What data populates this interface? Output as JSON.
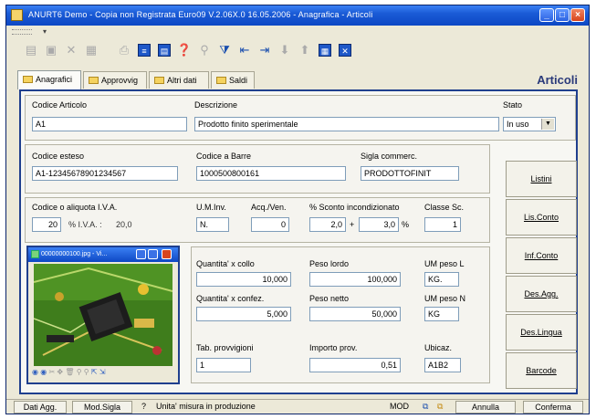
{
  "window": {
    "title": "ANURT6  Demo - Copia non Registrata          Euro09 V.2.06X.0 16.05.2006 - Anagrafica - Articoli"
  },
  "tabs": [
    {
      "label": "Anagrafici"
    },
    {
      "label": "Approvvig"
    },
    {
      "label": "Altri dati"
    },
    {
      "label": "Saldi"
    }
  ],
  "page_title": "Articoli",
  "form": {
    "codice_articolo": {
      "label": "Codice Articolo",
      "value": "A1"
    },
    "descrizione": {
      "label": "Descrizione",
      "value": "Prodotto finito sperimentale"
    },
    "stato": {
      "label": "Stato",
      "value": "In uso"
    },
    "codice_esteso": {
      "label": "Codice esteso",
      "value": "A1-12345678901234567"
    },
    "codice_barre": {
      "label": "Codice a Barre",
      "value": "1000500800161"
    },
    "sigla_commerc": {
      "label": "Sigla commerc.",
      "value": "PRODOTTOFINIT"
    },
    "codice_iva": {
      "label": "Codice o aliquota I.V.A.",
      "value": "20",
      "pct_label": "% I.V.A. :",
      "pct_value": "20,0"
    },
    "um_inv": {
      "label": "U.M.Inv.",
      "value": "N."
    },
    "acq_ven": {
      "label": "Acq./Ven.",
      "value": "0"
    },
    "sconto": {
      "label": "% Sconto incondizionato",
      "value1": "2,0",
      "plus": "+",
      "value2": "3,0",
      "pct": "%"
    },
    "classe_sc": {
      "label": "Classe Sc.",
      "value": "1"
    },
    "qta_collo": {
      "label": "Quantita' x collo",
      "value": "10,000"
    },
    "peso_lordo": {
      "label": "Peso lordo",
      "value": "100,000"
    },
    "um_peso_l": {
      "label": "UM peso L",
      "value": "KG."
    },
    "qta_confez": {
      "label": "Quantita' x confez.",
      "value": "5,000"
    },
    "peso_netto": {
      "label": "Peso netto",
      "value": "50,000"
    },
    "um_peso_n": {
      "label": "UM peso N",
      "value": "KG"
    },
    "tab_provvigioni": {
      "label": "Tab. provvigioni",
      "value": "1"
    },
    "importo_prov": {
      "label": "Importo prov.",
      "value": "0,51"
    },
    "ubicaz": {
      "label": "Ubicaz.",
      "value": "A1B2"
    }
  },
  "right_buttons": [
    "Listini",
    "Lis.Conto",
    "Inf.Conto",
    "Des.Agg.",
    "Des.Lingua",
    "Barcode"
  ],
  "image_window": {
    "title": "00000000100.jpg - Vi..."
  },
  "status": {
    "dati_agg": "Dati Agg.",
    "mod_sigla": "Mod.Sigla",
    "help": "?",
    "message": "Unita' misura in produzione",
    "mode": "MOD",
    "annulla": "Annulla",
    "conferma": "Conferma"
  },
  "colors": {
    "title_blue": "#0d47c4",
    "panel_border": "#1f3f8e",
    "accent": "#2a3a7a"
  }
}
